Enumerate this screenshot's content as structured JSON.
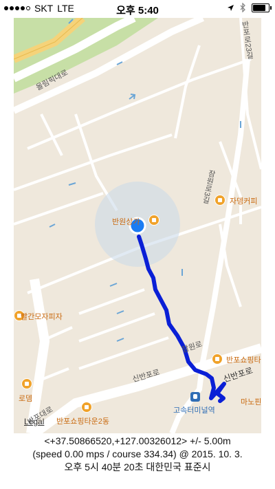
{
  "status_bar": {
    "carrier": "SKT",
    "network": "LTE",
    "time": "오후 5:40",
    "battery_level": 0.92
  },
  "map": {
    "colors": {
      "land": "#efe8dc",
      "park": "#c7dfa6",
      "route": "#0a1fd6",
      "location_dot": "#1a7cf3"
    },
    "street_labels": {
      "olympic": "올림픽대로",
      "banpo_23": "반포로23길",
      "jamwon_3": "잠원로3길",
      "jamwon": "잠원로",
      "sinbanpo": "신반포로",
      "sinbanpo_2": "신반포로",
      "banpo_daero": "반포대로"
    },
    "poi_labels": {
      "banwon": "반원상가",
      "jadenk": "자뎅커피",
      "ppalgan": "빨간모자피자",
      "banpo_shopping": "반포쇼핑타",
      "rodem": "로뎀",
      "banpo_shopping_2": "반포쇼핑타운2동",
      "mano": "마노핀"
    },
    "station_label": "고속터미널역",
    "legal": "Legal"
  },
  "location_info": {
    "line1": "<+37.50866520,+127.00326012> +/- 5.00m",
    "line2": "(speed 0.00 mps / course 334.34) @ 2015. 10. 3.",
    "line3": "오후 5시 40분 20초 대한민국 표준시"
  }
}
